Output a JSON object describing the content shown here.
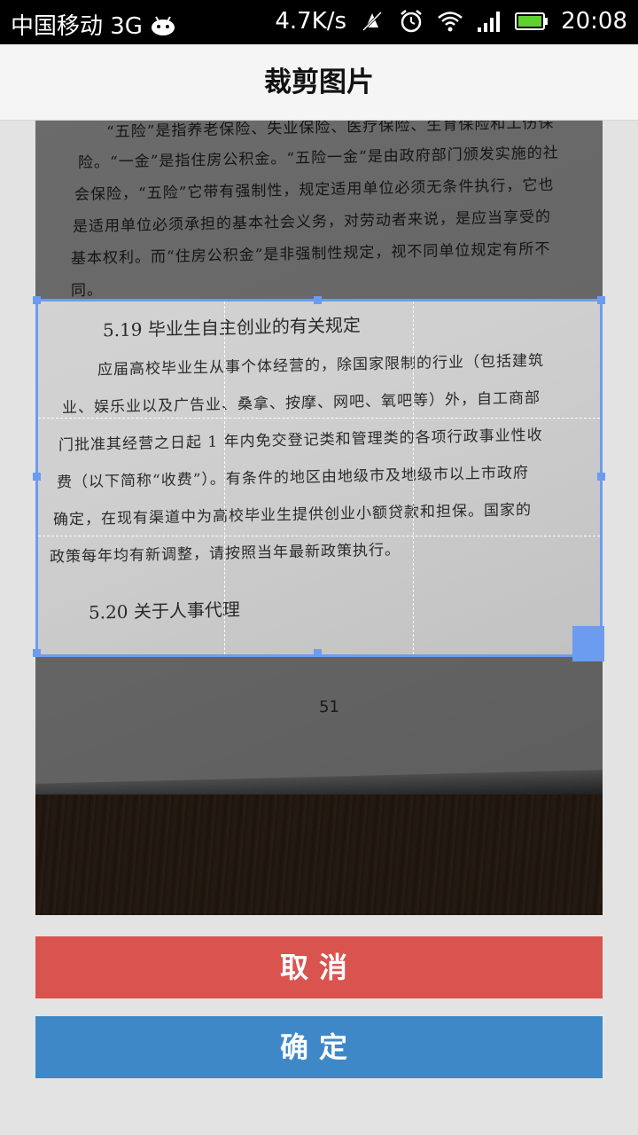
{
  "status_bar": {
    "carrier": "中国移动 3G",
    "speed": "4.7K/s",
    "time": "20:08",
    "icons": [
      "android-icon",
      "no-notification-icon",
      "alarm-icon",
      "wifi-icon",
      "signal-icon",
      "battery-icon"
    ]
  },
  "header": {
    "title": "裁剪图片"
  },
  "photo": {
    "lines": [
      "“五险”是指养老保险、失业保险、医疗保险、生育保险和工伤保",
      "险。“一金”是指住房公积金。“五险一金”是由政府部门颁发实施的社",
      "会保险，“五险”它带有强制性，规定适用单位必须无条件执行，它也",
      "是适用单位必须承担的基本社会义务，对劳动者来说，是应当享受的",
      "基本权利。而“住房公积金”是非强制性规定，视不同单位规定有所不",
      "同。"
    ],
    "heading_1": "5.19 毕业生自主创业的有关规定",
    "body_lines": [
      "应届高校毕业生从事个体经营的，除国家限制的行业（包括建筑",
      "业、娱乐业以及广告业、桑拿、按摩、网吧、氧吧等）外，自工商部",
      "门批准其经营之日起 1 年内免交登记类和管理类的各项行政事业性收",
      "费（以下简称“收费”）。有条件的地区由地级市及地级市以上市政府",
      "确定，在现有渠道中为高校毕业生提供创业小额贷款和担保。国家的",
      "政策每年均有新调整，请按照当年最新政策执行。"
    ],
    "heading_2": "5.20 关于人事代理",
    "page_number": "51"
  },
  "actions": {
    "cancel_label": "取消",
    "confirm_label": "确定"
  },
  "colors": {
    "crop_frame": "#6b9cf0",
    "cancel": "#d9534f",
    "confirm": "#3f88c8"
  }
}
